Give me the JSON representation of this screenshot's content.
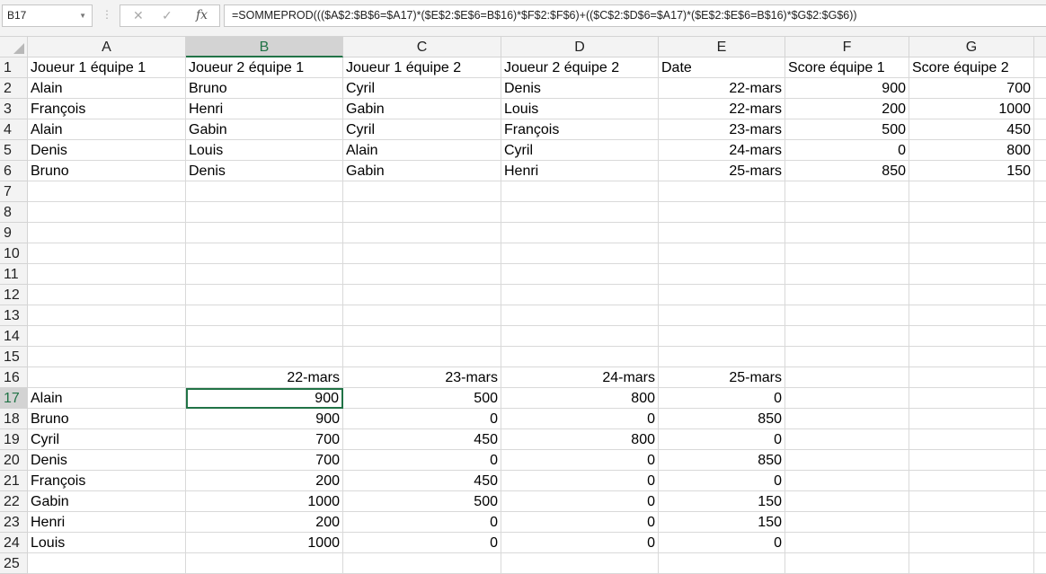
{
  "name_box": "B17",
  "formula": "=SOMMEPROD((($A$2:$B$6=$A17)*($E$2:$E$6=B$16)*$F$2:$F$6)+(($C$2:$D$6=$A17)*($E$2:$E$6=B$16)*$G$2:$G$6))",
  "columns": [
    "A",
    "B",
    "C",
    "D",
    "E",
    "F",
    "G",
    ""
  ],
  "selected_column": "B",
  "selected_row": "17",
  "active_cell": "B17",
  "rows": [
    {
      "n": "1",
      "c": [
        "Joueur 1 équipe 1",
        "Joueur 2 équipe 1",
        "Joueur 1 équipe 2",
        "Joueur 2 équipe 2",
        "Date",
        "Score équipe 1",
        "Score équipe 2"
      ]
    },
    {
      "n": "2",
      "c": [
        "Alain",
        "Bruno",
        "Cyril",
        "Denis",
        "22-mars",
        "900",
        "700"
      ]
    },
    {
      "n": "3",
      "c": [
        "François",
        "Henri",
        "Gabin",
        "Louis",
        "22-mars",
        "200",
        "1000"
      ]
    },
    {
      "n": "4",
      "c": [
        "Alain",
        "Gabin",
        "Cyril",
        "François",
        "23-mars",
        "500",
        "450"
      ]
    },
    {
      "n": "5",
      "c": [
        "Denis",
        "Louis",
        "Alain",
        "Cyril",
        "24-mars",
        "0",
        "800"
      ]
    },
    {
      "n": "6",
      "c": [
        "Bruno",
        "Denis",
        "Gabin",
        "Henri",
        "25-mars",
        "850",
        "150"
      ]
    },
    {
      "n": "7",
      "c": []
    },
    {
      "n": "8",
      "c": []
    },
    {
      "n": "9",
      "c": []
    },
    {
      "n": "10",
      "c": []
    },
    {
      "n": "11",
      "c": []
    },
    {
      "n": "12",
      "c": []
    },
    {
      "n": "13",
      "c": []
    },
    {
      "n": "14",
      "c": []
    },
    {
      "n": "15",
      "c": []
    },
    {
      "n": "16",
      "c": [
        "",
        "22-mars",
        "23-mars",
        "24-mars",
        "25-mars"
      ]
    },
    {
      "n": "17",
      "c": [
        "Alain",
        "900",
        "500",
        "800",
        "0"
      ]
    },
    {
      "n": "18",
      "c": [
        "Bruno",
        "900",
        "0",
        "0",
        "850"
      ]
    },
    {
      "n": "19",
      "c": [
        "Cyril",
        "700",
        "450",
        "800",
        "0"
      ]
    },
    {
      "n": "20",
      "c": [
        "Denis",
        "700",
        "0",
        "0",
        "850"
      ]
    },
    {
      "n": "21",
      "c": [
        "François",
        "200",
        "450",
        "0",
        "0"
      ]
    },
    {
      "n": "22",
      "c": [
        "Gabin",
        "1000",
        "500",
        "0",
        "150"
      ]
    },
    {
      "n": "23",
      "c": [
        "Henri",
        "200",
        "0",
        "0",
        "150"
      ]
    },
    {
      "n": "24",
      "c": [
        "Louis",
        "1000",
        "0",
        "0",
        "0"
      ]
    },
    {
      "n": "25",
      "c": []
    }
  ]
}
